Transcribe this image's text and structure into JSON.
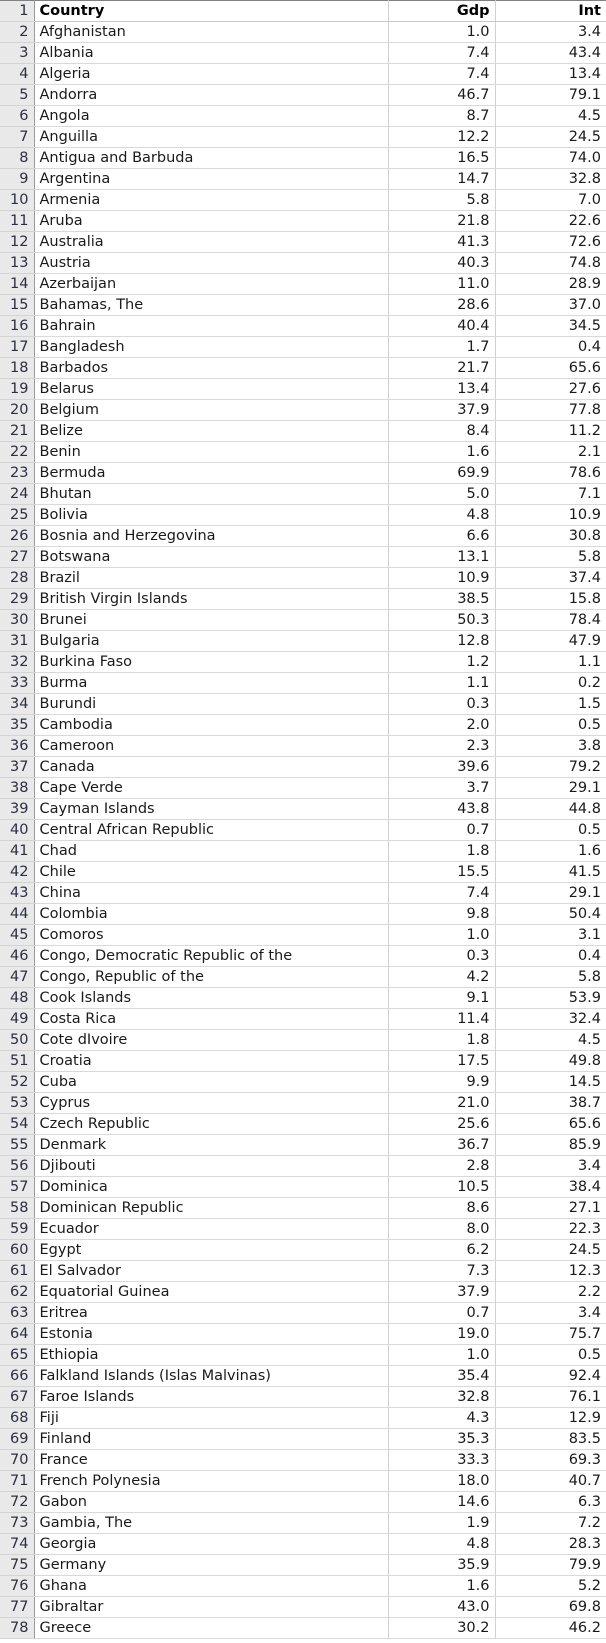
{
  "sheet": {
    "columns": [
      {
        "key": "country",
        "header": "Country",
        "align": "left"
      },
      {
        "key": "gdp",
        "header": "Gdp",
        "align": "right"
      },
      {
        "key": "int",
        "header": "Int",
        "align": "right"
      }
    ],
    "header_row_number": "1",
    "first_data_row_number": 2,
    "row_numbers_visible": [
      "1",
      "2",
      "3",
      "4",
      "5",
      "6",
      "7",
      "8",
      "9",
      "10",
      "11",
      "12",
      "13",
      "14",
      "15",
      "16",
      "17",
      "18",
      "19",
      "20",
      "21",
      "22",
      "23",
      "24",
      "25",
      "26",
      "27",
      "28",
      "29",
      "30",
      "31",
      "32",
      "33",
      "34",
      "35",
      "36",
      "37",
      "38",
      "39",
      "40",
      "41",
      "42",
      "43",
      "44",
      "45",
      "46",
      "47",
      "48",
      "49",
      "50",
      "51",
      "52",
      "53",
      "54",
      "55",
      "56",
      "57",
      "58",
      "59",
      "60",
      "61",
      "62",
      "63",
      "64",
      "65",
      "66",
      "67",
      "68",
      "69",
      "70",
      "71",
      "72",
      "73",
      "74",
      "75",
      "76",
      "77",
      "78"
    ],
    "colors": {
      "row_header_bg": "#e9e9e9",
      "row_header_text": "#2a2f45",
      "cell_bg": "#ffffff",
      "cell_text": "#1a1a1a",
      "gridline": "#d0d0d0",
      "gutter_border": "#9a9a9a",
      "top_border": "#808080"
    },
    "rows": [
      {
        "n": "2",
        "country": "Afghanistan",
        "gdp": "1.0",
        "int": "3.4"
      },
      {
        "n": "3",
        "country": "Albania",
        "gdp": "7.4",
        "int": "43.4"
      },
      {
        "n": "4",
        "country": "Algeria",
        "gdp": "7.4",
        "int": "13.4"
      },
      {
        "n": "5",
        "country": "Andorra",
        "gdp": "46.7",
        "int": "79.1"
      },
      {
        "n": "6",
        "country": "Angola",
        "gdp": "8.7",
        "int": "4.5"
      },
      {
        "n": "7",
        "country": "Anguilla",
        "gdp": "12.2",
        "int": "24.5"
      },
      {
        "n": "8",
        "country": "Antigua and Barbuda",
        "gdp": "16.5",
        "int": "74.0"
      },
      {
        "n": "9",
        "country": "Argentina",
        "gdp": "14.7",
        "int": "32.8"
      },
      {
        "n": "10",
        "country": "Armenia",
        "gdp": "5.8",
        "int": "7.0"
      },
      {
        "n": "11",
        "country": "Aruba",
        "gdp": "21.8",
        "int": "22.6"
      },
      {
        "n": "12",
        "country": "Australia",
        "gdp": "41.3",
        "int": "72.6"
      },
      {
        "n": "13",
        "country": "Austria",
        "gdp": "40.3",
        "int": "74.8"
      },
      {
        "n": "14",
        "country": "Azerbaijan",
        "gdp": "11.0",
        "int": "28.9"
      },
      {
        "n": "15",
        "country": "Bahamas, The",
        "gdp": "28.6",
        "int": "37.0"
      },
      {
        "n": "16",
        "country": "Bahrain",
        "gdp": "40.4",
        "int": "34.5"
      },
      {
        "n": "17",
        "country": "Bangladesh",
        "gdp": "1.7",
        "int": "0.4"
      },
      {
        "n": "18",
        "country": "Barbados",
        "gdp": "21.7",
        "int": "65.6"
      },
      {
        "n": "19",
        "country": "Belarus",
        "gdp": "13.4",
        "int": "27.6"
      },
      {
        "n": "20",
        "country": "Belgium",
        "gdp": "37.9",
        "int": "77.8"
      },
      {
        "n": "21",
        "country": "Belize",
        "gdp": "8.4",
        "int": "11.2"
      },
      {
        "n": "22",
        "country": "Benin",
        "gdp": "1.6",
        "int": "2.1"
      },
      {
        "n": "23",
        "country": "Bermuda",
        "gdp": "69.9",
        "int": "78.6"
      },
      {
        "n": "24",
        "country": "Bhutan",
        "gdp": "5.0",
        "int": "7.1"
      },
      {
        "n": "25",
        "country": "Bolivia",
        "gdp": "4.8",
        "int": "10.9"
      },
      {
        "n": "26",
        "country": "Bosnia and Herzegovina",
        "gdp": "6.6",
        "int": "30.8"
      },
      {
        "n": "27",
        "country": "Botswana",
        "gdp": "13.1",
        "int": "5.8"
      },
      {
        "n": "28",
        "country": "Brazil",
        "gdp": "10.9",
        "int": "37.4"
      },
      {
        "n": "29",
        "country": "British Virgin Islands",
        "gdp": "38.5",
        "int": "15.8"
      },
      {
        "n": "30",
        "country": "Brunei",
        "gdp": "50.3",
        "int": "78.4"
      },
      {
        "n": "31",
        "country": "Bulgaria",
        "gdp": "12.8",
        "int": "47.9"
      },
      {
        "n": "32",
        "country": "Burkina Faso",
        "gdp": "1.2",
        "int": "1.1"
      },
      {
        "n": "33",
        "country": "Burma",
        "gdp": "1.1",
        "int": "0.2"
      },
      {
        "n": "34",
        "country": "Burundi",
        "gdp": "0.3",
        "int": "1.5"
      },
      {
        "n": "35",
        "country": "Cambodia",
        "gdp": "2.0",
        "int": "0.5"
      },
      {
        "n": "36",
        "country": "Cameroon",
        "gdp": "2.3",
        "int": "3.8"
      },
      {
        "n": "37",
        "country": "Canada",
        "gdp": "39.6",
        "int": "79.2"
      },
      {
        "n": "38",
        "country": "Cape Verde",
        "gdp": "3.7",
        "int": "29.1"
      },
      {
        "n": "39",
        "country": "Cayman Islands",
        "gdp": "43.8",
        "int": "44.8"
      },
      {
        "n": "40",
        "country": "Central African Republic",
        "gdp": "0.7",
        "int": "0.5"
      },
      {
        "n": "41",
        "country": "Chad",
        "gdp": "1.8",
        "int": "1.6"
      },
      {
        "n": "42",
        "country": "Chile",
        "gdp": "15.5",
        "int": "41.5"
      },
      {
        "n": "43",
        "country": "China",
        "gdp": "7.4",
        "int": "29.1"
      },
      {
        "n": "44",
        "country": "Colombia",
        "gdp": "9.8",
        "int": "50.4"
      },
      {
        "n": "45",
        "country": "Comoros",
        "gdp": "1.0",
        "int": "3.1"
      },
      {
        "n": "46",
        "country": "Congo, Democratic Republic of the",
        "gdp": "0.3",
        "int": "0.4"
      },
      {
        "n": "47",
        "country": "Congo, Republic of the",
        "gdp": "4.2",
        "int": "5.8"
      },
      {
        "n": "48",
        "country": "Cook Islands",
        "gdp": "9.1",
        "int": "53.9"
      },
      {
        "n": "49",
        "country": "Costa Rica",
        "gdp": "11.4",
        "int": "32.4"
      },
      {
        "n": "50",
        "country": "Cote dIvoire",
        "gdp": "1.8",
        "int": "4.5"
      },
      {
        "n": "51",
        "country": "Croatia",
        "gdp": "17.5",
        "int": "49.8"
      },
      {
        "n": "52",
        "country": "Cuba",
        "gdp": "9.9",
        "int": "14.5"
      },
      {
        "n": "53",
        "country": "Cyprus",
        "gdp": "21.0",
        "int": "38.7"
      },
      {
        "n": "54",
        "country": "Czech Republic",
        "gdp": "25.6",
        "int": "65.6"
      },
      {
        "n": "55",
        "country": "Denmark",
        "gdp": "36.7",
        "int": "85.9"
      },
      {
        "n": "56",
        "country": "Djibouti",
        "gdp": "2.8",
        "int": "3.4"
      },
      {
        "n": "57",
        "country": "Dominica",
        "gdp": "10.5",
        "int": "38.4"
      },
      {
        "n": "58",
        "country": "Dominican Republic",
        "gdp": "8.6",
        "int": "27.1"
      },
      {
        "n": "59",
        "country": "Ecuador",
        "gdp": "8.0",
        "int": "22.3"
      },
      {
        "n": "60",
        "country": "Egypt",
        "gdp": "6.2",
        "int": "24.5"
      },
      {
        "n": "61",
        "country": "El Salvador",
        "gdp": "7.3",
        "int": "12.3"
      },
      {
        "n": "62",
        "country": "Equatorial Guinea",
        "gdp": "37.9",
        "int": "2.2"
      },
      {
        "n": "63",
        "country": "Eritrea",
        "gdp": "0.7",
        "int": "3.4"
      },
      {
        "n": "64",
        "country": "Estonia",
        "gdp": "19.0",
        "int": "75.7"
      },
      {
        "n": "65",
        "country": "Ethiopia",
        "gdp": "1.0",
        "int": "0.5"
      },
      {
        "n": "66",
        "country": "Falkland Islands (Islas Malvinas)",
        "gdp": "35.4",
        "int": "92.4"
      },
      {
        "n": "67",
        "country": "Faroe Islands",
        "gdp": "32.8",
        "int": "76.1"
      },
      {
        "n": "68",
        "country": "Fiji",
        "gdp": "4.3",
        "int": "12.9"
      },
      {
        "n": "69",
        "country": "Finland",
        "gdp": "35.3",
        "int": "83.5"
      },
      {
        "n": "70",
        "country": "France",
        "gdp": "33.3",
        "int": "69.3"
      },
      {
        "n": "71",
        "country": "French Polynesia",
        "gdp": "18.0",
        "int": "40.7"
      },
      {
        "n": "72",
        "country": "Gabon",
        "gdp": "14.6",
        "int": "6.3"
      },
      {
        "n": "73",
        "country": "Gambia, The",
        "gdp": "1.9",
        "int": "7.2"
      },
      {
        "n": "74",
        "country": "Georgia",
        "gdp": "4.8",
        "int": "28.3"
      },
      {
        "n": "75",
        "country": "Germany",
        "gdp": "35.9",
        "int": "79.9"
      },
      {
        "n": "76",
        "country": "Ghana",
        "gdp": "1.6",
        "int": "5.2"
      },
      {
        "n": "77",
        "country": "Gibraltar",
        "gdp": "43.0",
        "int": "69.8"
      },
      {
        "n": "78",
        "country": "Greece",
        "gdp": "30.2",
        "int": "46.2"
      }
    ]
  }
}
